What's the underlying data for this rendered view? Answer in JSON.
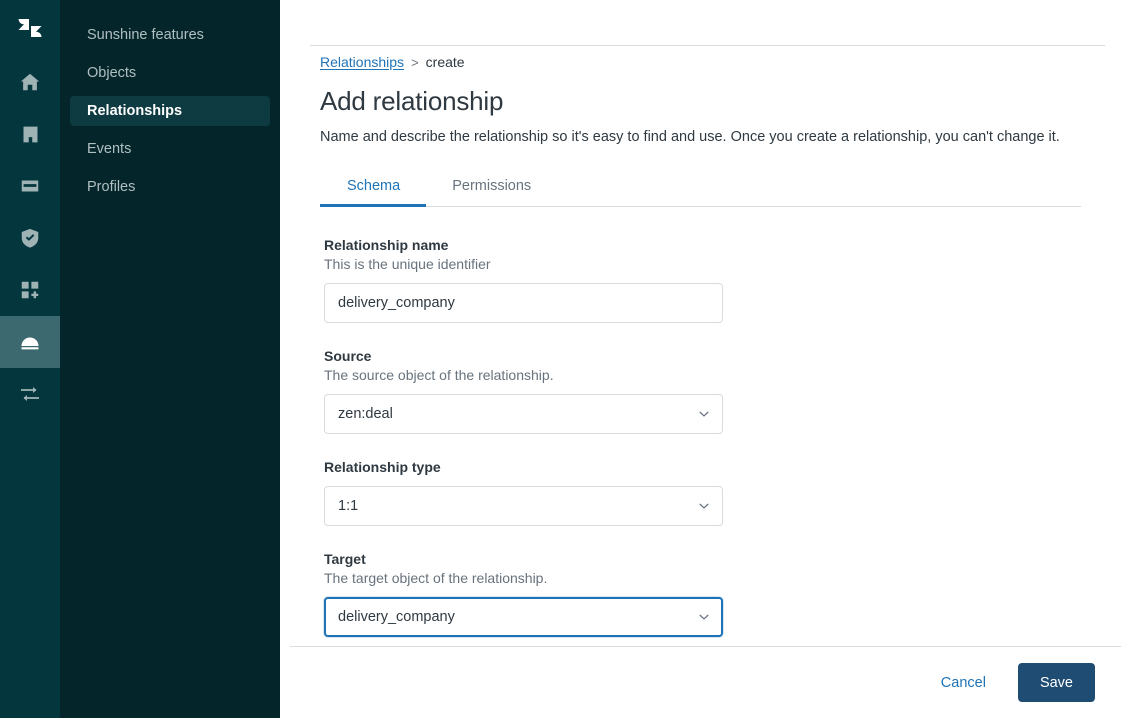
{
  "rail": {
    "logo": {
      "name": "zendesk-logo-icon"
    },
    "items": [
      {
        "icon": "home-icon",
        "active": false
      },
      {
        "icon": "building-icon",
        "active": false
      },
      {
        "icon": "card-icon",
        "active": false
      },
      {
        "icon": "shield-check-icon",
        "active": false
      },
      {
        "icon": "apps-add-icon",
        "active": false
      },
      {
        "icon": "sunshine-icon",
        "active": true
      },
      {
        "icon": "transfer-arrows-icon",
        "active": false
      }
    ]
  },
  "sidebar": {
    "items": [
      {
        "label": "Sunshine features",
        "active": false
      },
      {
        "label": "Objects",
        "active": false
      },
      {
        "label": "Relationships",
        "active": true
      },
      {
        "label": "Events",
        "active": false
      },
      {
        "label": "Profiles",
        "active": false
      }
    ]
  },
  "breadcrumb": {
    "link": "Relationships",
    "separator": ">",
    "current": "create"
  },
  "header": {
    "title": "Add relationship",
    "description": "Name and describe the relationship so it's easy to find and use. Once you create a relationship, you can't change it."
  },
  "tabs": [
    {
      "label": "Schema",
      "active": true
    },
    {
      "label": "Permissions",
      "active": false
    }
  ],
  "form": {
    "fields": [
      {
        "label": "Relationship name",
        "hint": "This is the unique identifier",
        "type": "text",
        "value": "delivery_company",
        "placeholder": "",
        "focused": false
      },
      {
        "label": "Source",
        "hint": "The source object of the relationship.",
        "type": "select",
        "value": "zen:deal",
        "focused": false
      },
      {
        "label": "Relationship type",
        "hint": "",
        "type": "select",
        "value": "1:1",
        "focused": false
      },
      {
        "label": "Target",
        "hint": "The target object of the relationship.",
        "type": "select",
        "value": "delivery_company",
        "focused": true
      }
    ]
  },
  "footer": {
    "cancel_label": "Cancel",
    "save_label": "Save"
  },
  "colors": {
    "rail_bg": "#03363D",
    "nav_bg": "#04262B",
    "rail_active_bg": "#3B696F",
    "nav_active_bg": "#0D3B41",
    "link_blue": "#1f73b7",
    "save_button_bg": "#1F4C73",
    "border_gray": "#d8dcde",
    "text_dark": "#2f3941",
    "text_muted": "#68737d"
  }
}
